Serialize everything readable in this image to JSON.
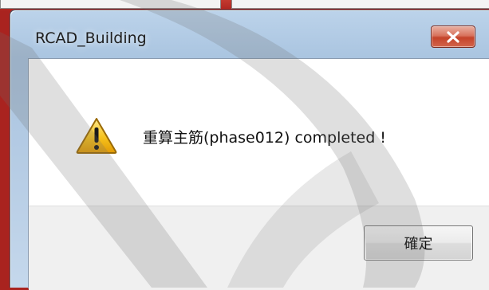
{
  "window": {
    "title": "RCAD_Building"
  },
  "dialog": {
    "message": "重算主筋(phase012) completed !",
    "ok_label": "確定"
  },
  "icons": {
    "close": "close-icon",
    "warning": "warning-icon"
  },
  "colors": {
    "close_button": "#c4432a",
    "title_bar": "#a9c4e0",
    "background": "#a9231f"
  }
}
